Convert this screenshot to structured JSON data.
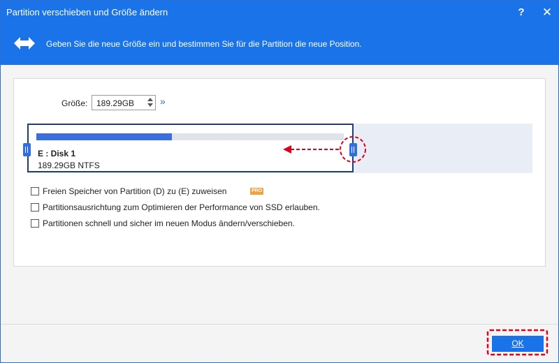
{
  "window": {
    "title": "Partition verschieben und Größe ändern",
    "help_label": "?",
    "close_label": "✕"
  },
  "header": {
    "icon": "resize-arrows-icon",
    "text": "Geben Sie die neue Größe ein und bestimmen Sie für die Partition die neue Position."
  },
  "size": {
    "label": "Größe:",
    "value": "189.29GB",
    "expand_label": "»"
  },
  "partition": {
    "name": "E : Disk 1",
    "info": "189.29GB NTFS",
    "used_fraction": 0.44
  },
  "options": [
    {
      "label": "Freien Speicher von Partition (D) zu (E) zuweisen",
      "checked": false,
      "badge": "PRO"
    },
    {
      "label": "Partitionsausrichtung zum Optimieren der Performance von SSD erlauben.",
      "checked": false
    },
    {
      "label": "Partitionen schnell und sicher im neuen Modus ändern/verschieben.",
      "checked": false
    }
  ],
  "footer": {
    "ok_label": "OK"
  },
  "colors": {
    "accent": "#1a73e8",
    "annotation": "#e0001b",
    "pro_badge": "#f2a23a"
  }
}
